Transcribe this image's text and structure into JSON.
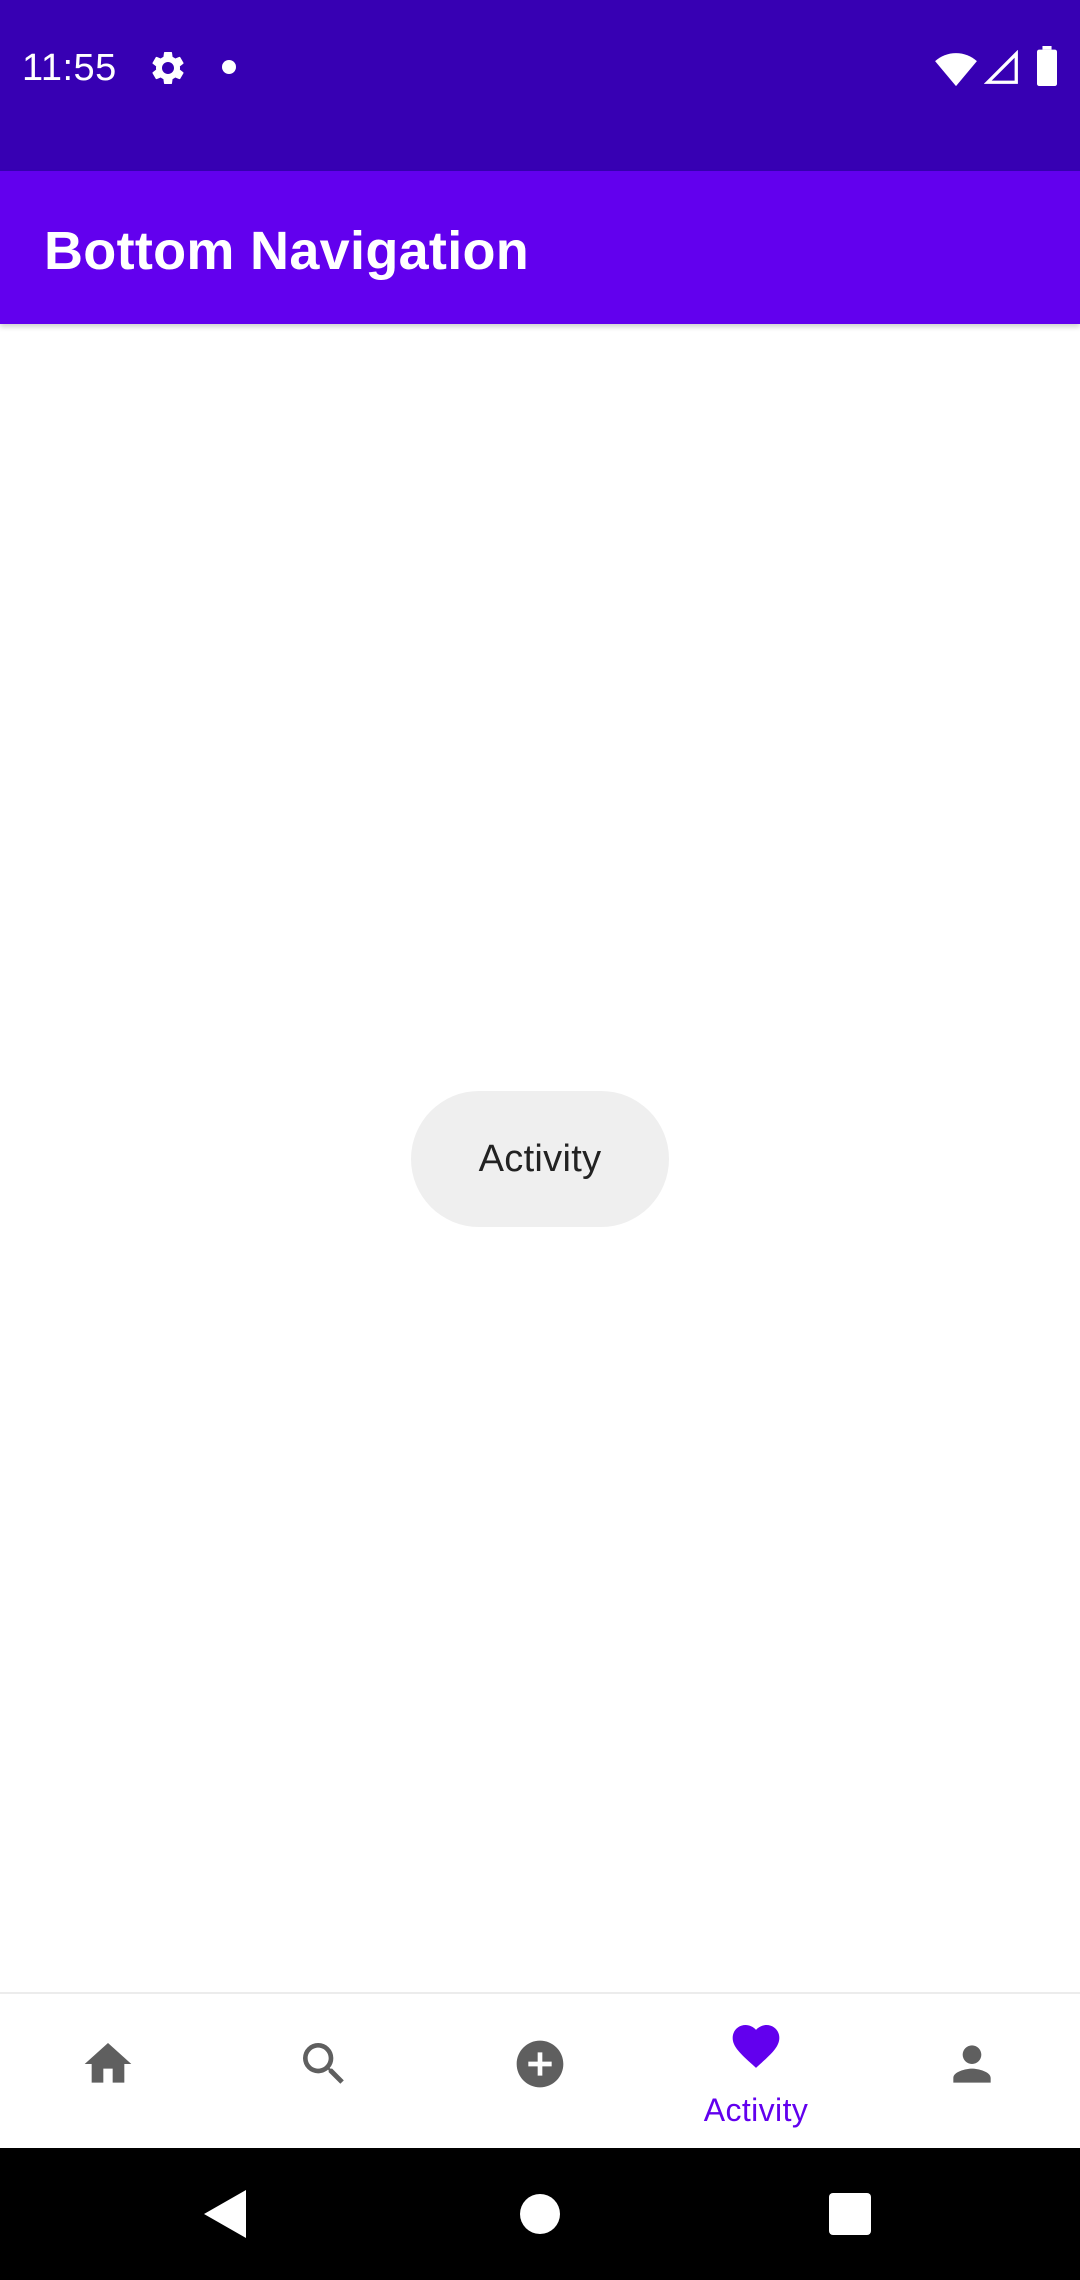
{
  "status_bar": {
    "time": "11:55",
    "icons": [
      "gear-icon",
      "notification-dot-icon",
      "wifi-icon",
      "signal-icon",
      "battery-icon"
    ]
  },
  "app_bar": {
    "title": "Bottom Navigation"
  },
  "content": {
    "center_label": "Activity"
  },
  "bottom_nav": {
    "items": [
      {
        "name": "Home",
        "icon": "home-icon",
        "label": "",
        "active": false
      },
      {
        "name": "Search",
        "icon": "search-icon",
        "label": "",
        "active": false
      },
      {
        "name": "Add",
        "icon": "add-circle-icon",
        "label": "",
        "active": false
      },
      {
        "name": "Activity",
        "icon": "heart-icon",
        "label": "Activity",
        "active": true
      },
      {
        "name": "Profile",
        "icon": "person-icon",
        "label": "",
        "active": false
      }
    ]
  },
  "system_nav": {
    "icons": [
      "back-icon",
      "home-circle-icon",
      "recents-icon"
    ]
  },
  "colors": {
    "status_bar": "#3700B3",
    "app_bar": "#6200EE",
    "accent": "#6200EE",
    "inactive_icon": "#5F5F5F",
    "chip_background": "#EFEFEF",
    "system_nav": "#000000"
  }
}
